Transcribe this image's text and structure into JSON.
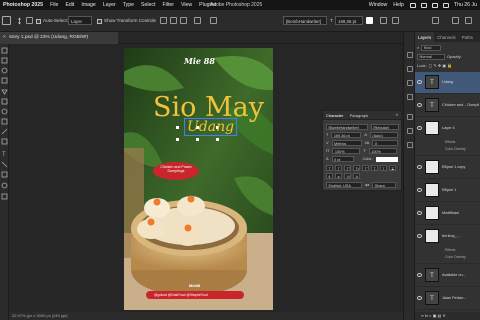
{
  "menubar": {
    "app_name": "Photoshop 2025",
    "items": [
      "File",
      "Edit",
      "Image",
      "Layer",
      "Type",
      "Select",
      "Filter",
      "View",
      "Plugins"
    ],
    "window_title": "Adobe Photoshop 2025",
    "right_items": [
      "Window",
      "Help"
    ],
    "clock": "Thu 26 Ju"
  },
  "options_bar": {
    "auto_select_label": "Auto-Select:",
    "auto_select_target": "Layer",
    "transform_controls_label": "Show Transform Controls",
    "font_family": "[BombHandwriter]",
    "font_size": "169,36 pt",
    "swatch_color": "#ffffff"
  },
  "document_tab": {
    "label": "story 1.psd @ 23% (Udang, RGB/8#)"
  },
  "canvas": {
    "brand": "Mie 88",
    "headline": "Sio May",
    "script_word": "Udang",
    "badge_line1": "Chicken and Prawn",
    "badge_line2": "Dumplings",
    "footer_logo": "Mie88",
    "footer_text": "@gofood @GrabFood @ShopeeFood",
    "accent_yellow": "#f2c23a",
    "badge_red": "#c8262b"
  },
  "status_bar": {
    "text": "22.97% (px x 3000 px (240 ppi)"
  },
  "character_panel": {
    "tabs": [
      "Character",
      "Paragraph"
    ],
    "font_family": "[BombHandwriter]",
    "font_style": "[Regular]",
    "font_size": "169,36 pt",
    "leading": "(Auto)",
    "kerning": "Metrics",
    "tracking": "0",
    "vertical_scale": "100%",
    "horizontal_scale": "100%",
    "baseline": "0 pt",
    "color_label": "Color:",
    "language": "English: USA",
    "antialias": "Sharp",
    "style_buttons": [
      "T",
      "T",
      "TT",
      "Tr",
      "T'",
      "T,",
      "T",
      "T"
    ]
  },
  "layers_panel": {
    "tabs": [
      "Layers",
      "Channels",
      "Paths"
    ],
    "search_placeholder": "Kind",
    "blend_mode": "Normal",
    "opacity_label": "Opacity:",
    "lock_label": "Lock:",
    "fill_label": "Fill:",
    "layers": [
      {
        "name": "Udang",
        "type": "text",
        "selected": true
      },
      {
        "name": "Chicken and... Dumplings",
        "type": "text",
        "selected": false
      },
      {
        "name": "Layer 4",
        "type": "pixel",
        "selected": false,
        "effects": [
          "Effects",
          "Color Overlay"
        ]
      },
      {
        "name": "Ellipse 1 copy",
        "type": "pixel",
        "selected": false
      },
      {
        "name": "Ellipse 1",
        "type": "pixel",
        "selected": false
      },
      {
        "name": "Modifikasi",
        "type": "pixel",
        "selected": false
      },
      {
        "name": "territory_...",
        "type": "pixel",
        "selected": false,
        "effects": [
          "Effects",
          "Color Overlay"
        ]
      },
      {
        "name": "Available on...",
        "type": "text",
        "selected": false
      },
      {
        "name": "Jalan Pertan...",
        "type": "text",
        "selected": false
      }
    ]
  }
}
